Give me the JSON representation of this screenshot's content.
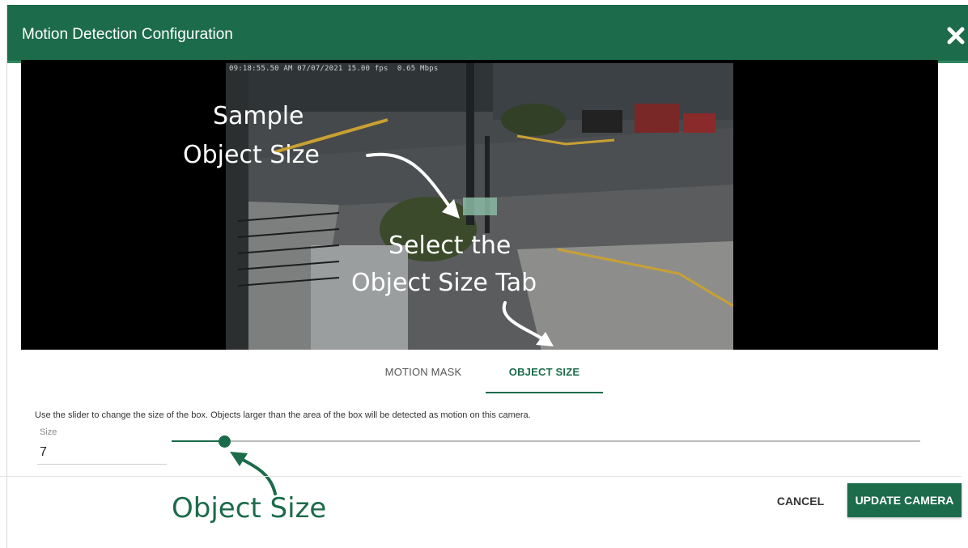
{
  "dialog": {
    "title": "Motion Detection Configuration",
    "close_icon": "close-icon"
  },
  "video": {
    "timestamp_overlay": "09:18:55.50 AM 07/07/2021 15.00 fps  0.65 Mbps",
    "annotation_sample_line1": "Sample",
    "annotation_sample_line2": "Object Size",
    "annotation_tab_line1": "Select the",
    "annotation_tab_line2": "Object Size Tab"
  },
  "tabs": [
    {
      "label": "MOTION MASK",
      "active": false
    },
    {
      "label": "OBJECT SIZE",
      "active": true
    }
  ],
  "object_size": {
    "help_text": "Use the slider to change the size of the box. Objects larger than the area of the box will be detected as motion on this camera.",
    "size_label": "Size",
    "size_value": "7"
  },
  "annotation_object_size": "Object Size",
  "footer": {
    "cancel_label": "CANCEL",
    "update_label": "UPDATE CAMERA"
  },
  "colors": {
    "brand_green": "#1c6b4b",
    "annotation_green": "#1c6b4b"
  }
}
